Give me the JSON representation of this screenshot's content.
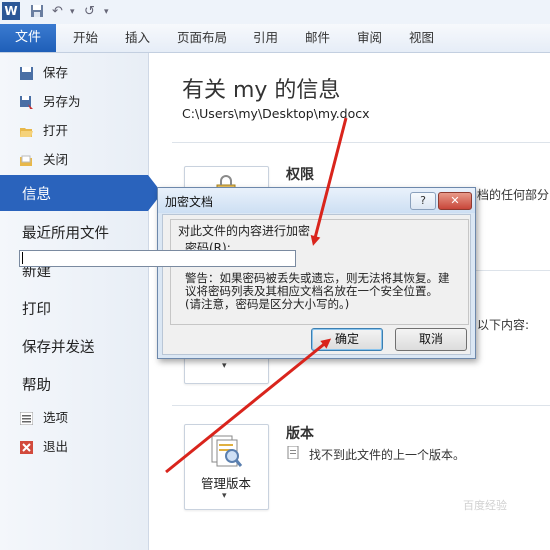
{
  "qat": {
    "app_logo": "W",
    "save_icon": "save-icon",
    "undo_glyph": "↶",
    "redo_glyph": "↺",
    "dropdown_glyph": "▾"
  },
  "ribbon": {
    "file_tab": "文件",
    "tabs": [
      "开始",
      "插入",
      "页面布局",
      "引用",
      "邮件",
      "审阅",
      "视图"
    ]
  },
  "left": {
    "small_items": [
      "保存",
      "另存为",
      "打开",
      "关闭"
    ],
    "selected": "信息",
    "big_items": [
      "最近所用文件",
      "新建",
      "打印",
      "保存并发送",
      "帮助"
    ],
    "bottom_items": [
      "选项",
      "退出"
    ]
  },
  "info": {
    "title": "有关 my 的信息",
    "path": "C:\\Users\\my\\Desktop\\my.docx",
    "permissions_title": "权限",
    "permissions_desc_tail": "档的任何部分",
    "inspect_desc_tail": "以下内容:",
    "versions_title": "版本",
    "versions_desc": "找不到此文件的上一个版本。",
    "manage_versions_label": "管理版本"
  },
  "dialog": {
    "title": "加密文档",
    "help_glyph": "?",
    "close_glyph": "✕",
    "description": "对此文件的内容进行加密",
    "password_label": "密码(R):",
    "password_value": "",
    "warning_lines": [
      "警告：如果密码被丢失或遗忘，则无法将其恢复。建",
      "议将密码列表及其相应文档名放在一个安全位置。",
      "(请注意，密码是区分大小写的。)"
    ],
    "ok_label": "确定",
    "cancel_label": "取消"
  },
  "colors": {
    "accent": "#2a63bc",
    "arrow": "#d9241c",
    "dialog_frame": "#dbe7f4"
  },
  "watermark": "百度经验"
}
